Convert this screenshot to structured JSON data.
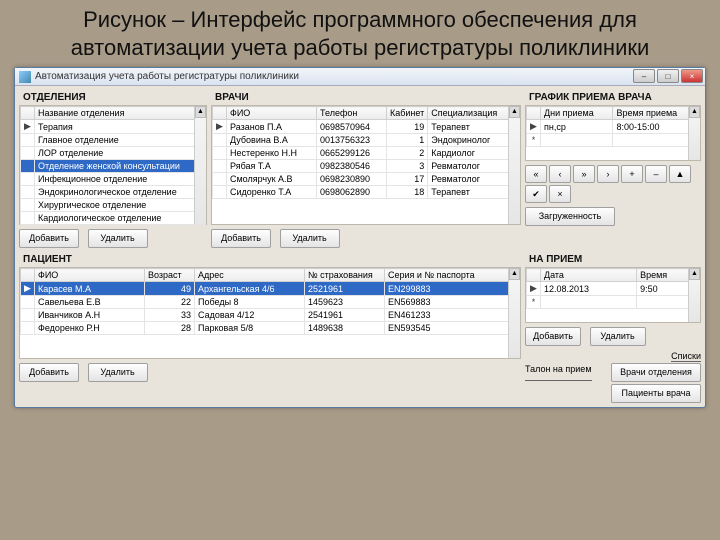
{
  "slide_title": "Рисунок – Интерфейс программного обеспечения для автоматизации учета работы регистратуры поликлиники",
  "window": {
    "title": "Автоматизация учета работы регистратуры поликлиники",
    "min": "–",
    "max": "□",
    "close": "×"
  },
  "departments": {
    "header": "ОТДЕЛЕНИЯ",
    "col_name": "Название отделения",
    "rows": [
      {
        "name": "Терапия",
        "sel": false
      },
      {
        "name": "Главное отделение",
        "sel": false
      },
      {
        "name": "ЛОР отделение",
        "sel": false
      },
      {
        "name": "Отделение женской консультации",
        "sel": true
      },
      {
        "name": "Инфекционное отделение",
        "sel": false
      },
      {
        "name": "Эндокринологическое отделение",
        "sel": false
      },
      {
        "name": "Хирургическое отделение",
        "sel": false
      },
      {
        "name": "Кардиологическое отделение",
        "sel": false
      }
    ],
    "add": "Добавить",
    "del": "Удалить"
  },
  "doctors": {
    "header": "ВРАЧИ",
    "cols": {
      "fio": "ФИО",
      "lic": "Телефон",
      "cab": "Кабинет",
      "spec": "Специализация"
    },
    "rows": [
      {
        "fio": "Разанов П.А",
        "lic": "0698570964",
        "cab": "19",
        "spec": "Терапевт"
      },
      {
        "fio": "Дубовина В.А",
        "lic": "0013756323",
        "cab": "1",
        "spec": "Эндокринолог"
      },
      {
        "fio": "Нестеренко Н.Н",
        "lic": "0665299126",
        "cab": "2",
        "spec": "Кардиолог"
      },
      {
        "fio": "Рябая Т.А",
        "lic": "0982380546",
        "cab": "3",
        "spec": "Ревматолог"
      },
      {
        "fio": "Смолярчук А.В",
        "lic": "0698230890",
        "cab": "17",
        "spec": "Ревматолог"
      },
      {
        "fio": "Сидоренко Т.А",
        "lic": "0698062890",
        "cab": "18",
        "spec": "Терапевт"
      }
    ],
    "add": "Добавить",
    "del": "Удалить"
  },
  "schedule": {
    "header": "ГРАФИК ПРИЕМА ВРАЧА",
    "cols": {
      "days": "Дни приема",
      "time": "Время приема"
    },
    "rows": [
      {
        "days": "пн,ср",
        "time": "8:00-15:00"
      }
    ],
    "nav": [
      "«",
      "‹",
      "»",
      "›",
      "+",
      "–",
      "▲",
      "✔",
      "×"
    ],
    "load": "Загруженность"
  },
  "patients": {
    "header": "ПАЦИЕНТ",
    "cols": {
      "fio": "ФИО",
      "age": "Возраст",
      "addr": "Адрес",
      "ins": "№ страхования",
      "pass": "Серия и № паспорта"
    },
    "rows": [
      {
        "fio": "Карасев М.А",
        "age": "49",
        "addr": "Архангельская 4/6",
        "ins": "2521961",
        "pass": "EN299883",
        "sel": true
      },
      {
        "fio": "Савельева Е.В",
        "age": "22",
        "addr": "Победы 8",
        "ins": "1459623",
        "pass": "EN569883",
        "sel": false
      },
      {
        "fio": "Иванчиков А.Н",
        "age": "33",
        "addr": "Садовая 4/12",
        "ins": "2541961",
        "pass": "EN461233",
        "sel": false
      },
      {
        "fio": "Федоренко Р.Н",
        "age": "28",
        "addr": "Парковая 5/8",
        "ins": "1489638",
        "pass": "EN593545",
        "sel": false
      }
    ],
    "add": "Добавить",
    "del": "Удалить"
  },
  "appointment": {
    "header": "НА ПРИЕМ",
    "cols": {
      "date": "Дата",
      "time": "Время"
    },
    "rows": [
      {
        "date": "12.08.2013",
        "time": "9:50"
      }
    ],
    "add": "Добавить",
    "del": "Удалить",
    "links_header": "Списки",
    "links": {
      "talon": "Талон на прием",
      "vrachi": "Врачи отделения",
      "pac": "Пациенты врача"
    }
  }
}
